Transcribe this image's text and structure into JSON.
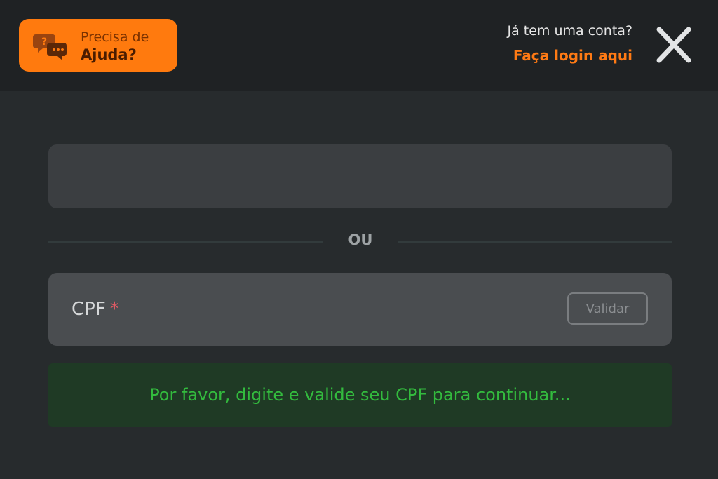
{
  "header": {
    "help": {
      "line1": "Precisa de",
      "line2": "Ajuda?",
      "icon": "chat-bubbles-icon"
    },
    "account_question": "Já tem uma conta?",
    "login_link": "Faça login aqui",
    "close_icon": "close-icon"
  },
  "form": {
    "divider_text": "OU",
    "cpf_label": "CPF",
    "cpf_required_mark": "*",
    "cpf_value": "",
    "validate_label": "Validar",
    "notice": "Por favor, digite e valide seu CPF para continuar..."
  },
  "colors": {
    "accent": "#ff7a0e",
    "success": "#33bb3e",
    "background": "#272b2d"
  }
}
